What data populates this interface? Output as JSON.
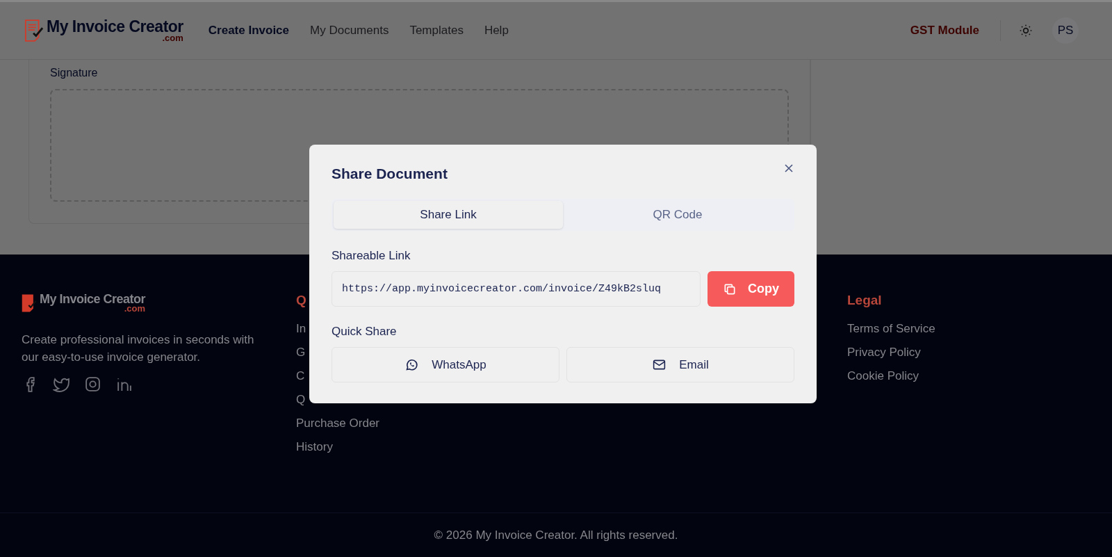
{
  "header": {
    "logo": {
      "name": "My Invoice Creator",
      "suffix": ".com"
    },
    "nav": [
      {
        "label": "Create Invoice",
        "selected": true
      },
      {
        "label": "My Documents",
        "selected": false
      },
      {
        "label": "Templates",
        "selected": false
      },
      {
        "label": "Help",
        "selected": false
      }
    ],
    "gst_link": "GST Module",
    "avatar": "PS"
  },
  "signature": {
    "label": "Signature"
  },
  "footer": {
    "logo": {
      "name": "My Invoice Creator",
      "suffix": ".com"
    },
    "tagline": "Create professional invoices in seconds with our easy-to-use invoice generator.",
    "columns": [
      {
        "heading": "Q",
        "links": [
          "In",
          "G",
          "C",
          "Q",
          "Purchase Order",
          "History"
        ]
      },
      {
        "heading": "Legal",
        "links": [
          "Terms of Service",
          "Privacy Policy",
          "Cookie Policy"
        ]
      }
    ],
    "copyright": "© 2026 My Invoice Creator. All rights reserved."
  },
  "dialog": {
    "title": "Share Document",
    "tabs": [
      {
        "label": "Share Link",
        "selected": true
      },
      {
        "label": "QR Code",
        "selected": false
      }
    ],
    "link_label": "Shareable Link",
    "link_value": "https://app.myinvoicecreator.com/invoice/Z49kB2sluq",
    "copy_button": "Copy",
    "quick_share_label": "Quick Share",
    "quick_share": [
      {
        "kind": "whatsapp",
        "label": "WhatsApp"
      },
      {
        "kind": "email",
        "label": "Email"
      }
    ]
  }
}
